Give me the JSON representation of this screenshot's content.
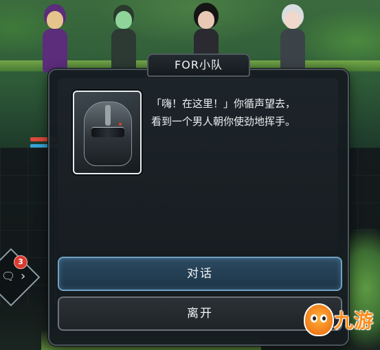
{
  "dialog": {
    "tab_title": "FOR小队",
    "message_line1": "「嗨！在这里！」你循声望去，",
    "message_line2": "看到一个男人朝你使劲地挥手。",
    "options": [
      {
        "label": "对话"
      },
      {
        "label": "离开"
      }
    ]
  },
  "hud": {
    "notification_count": "3"
  },
  "watermark": {
    "text": "九游"
  },
  "colors": {
    "primary_button_border": "#6fa2c4",
    "secondary_button_border": "#6b747a",
    "notification_badge": "#d83b2f",
    "dialog_background": "#161c20"
  }
}
